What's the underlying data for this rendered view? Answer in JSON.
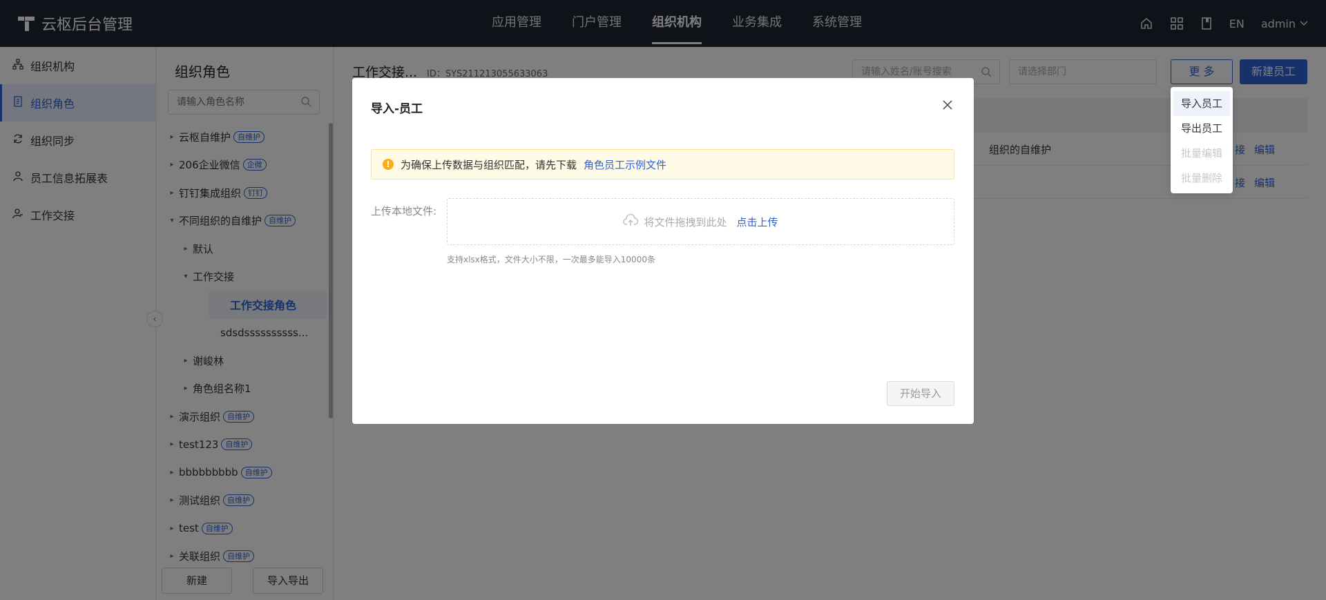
{
  "app": {
    "title": "云枢后台管理"
  },
  "nav": {
    "items": [
      "应用管理",
      "门户管理",
      "组织机构",
      "业务集成",
      "系统管理"
    ],
    "active_index": 2
  },
  "topright": {
    "lang": "EN",
    "user": "admin"
  },
  "sidebar": {
    "items": [
      {
        "label": "组织机构",
        "icon": "org-tree-icon"
      },
      {
        "label": "组织角色",
        "icon": "role-doc-icon",
        "active": true
      },
      {
        "label": "组织同步",
        "icon": "sync-icon"
      },
      {
        "label": "员工信息拓展表",
        "icon": "user-icon"
      },
      {
        "label": "工作交接",
        "icon": "handover-icon"
      }
    ]
  },
  "rolepanel": {
    "title": "组织角色",
    "search_placeholder": "请输入角色名称",
    "tree": [
      {
        "label": "云枢自维护",
        "badge": "自维护",
        "level": 0,
        "arrow": "right"
      },
      {
        "label": "206企业微信",
        "badge": "企微",
        "level": 0,
        "arrow": "right"
      },
      {
        "label": "钉钉集成组织",
        "badge": "钉钉",
        "level": 0,
        "arrow": "right"
      },
      {
        "label": "不同组织的自维护",
        "badge": "自维护",
        "level": 0,
        "arrow": "down"
      },
      {
        "label": "默认",
        "badge": "",
        "level": 1,
        "arrow": "right"
      },
      {
        "label": "工作交接",
        "badge": "",
        "level": 1,
        "arrow": "down"
      },
      {
        "label": "工作交接角色",
        "badge": "",
        "level": 2,
        "arrow": "",
        "selected": true
      },
      {
        "label": "sdsdssssssssss...",
        "badge": "",
        "level": 2,
        "arrow": ""
      },
      {
        "label": "谢峻林",
        "badge": "",
        "level": 1,
        "arrow": "right"
      },
      {
        "label": "角色组名称1",
        "badge": "",
        "level": 1,
        "arrow": "right"
      },
      {
        "label": "演示组织",
        "badge": "自维护",
        "level": 0,
        "arrow": "right"
      },
      {
        "label": "test123",
        "badge": "自维护",
        "level": 0,
        "arrow": "right"
      },
      {
        "label": "bbbbbbbbb",
        "badge": "自维护",
        "level": 0,
        "arrow": "right"
      },
      {
        "label": "测试组织",
        "badge": "自维护",
        "level": 0,
        "arrow": "right"
      },
      {
        "label": "test",
        "badge": "自维护",
        "level": 0,
        "arrow": "right"
      },
      {
        "label": "关联组织",
        "badge": "自维护",
        "level": 0,
        "arrow": "right"
      }
    ],
    "btn_new": "新建",
    "btn_import_export": "导入导出"
  },
  "main": {
    "title": "工作交接...",
    "id_text": "ID：SYS211213055633063",
    "search_placeholder": "请输入姓名/账号搜索",
    "dept_placeholder": "请选择部门",
    "more_label": "更 多",
    "new_label": "新建员工",
    "rows": [
      {
        "org": "组织的自维护",
        "link1": "接",
        "link2": "编辑"
      },
      {
        "org": "",
        "link1": "接",
        "link2": "编辑"
      }
    ]
  },
  "dropdown": {
    "items": [
      {
        "label": "导入员工",
        "state": "hover"
      },
      {
        "label": "导出员工",
        "state": "normal"
      },
      {
        "label": "批量编辑",
        "state": "disabled"
      },
      {
        "label": "批量删除",
        "state": "disabled"
      }
    ]
  },
  "modal": {
    "title": "导入-员工",
    "alert_text": "为确保上传数据与组织匹配，请先下载",
    "alert_link": "角色员工示例文件",
    "upload_label": "上传本地文件:",
    "dropzone_text": "将文件拖拽到此处",
    "dropzone_link": "点击上传",
    "hint": "支持xlsx格式，文件大小不限，一次最多能导入10000条",
    "start_label": "开始导入"
  }
}
